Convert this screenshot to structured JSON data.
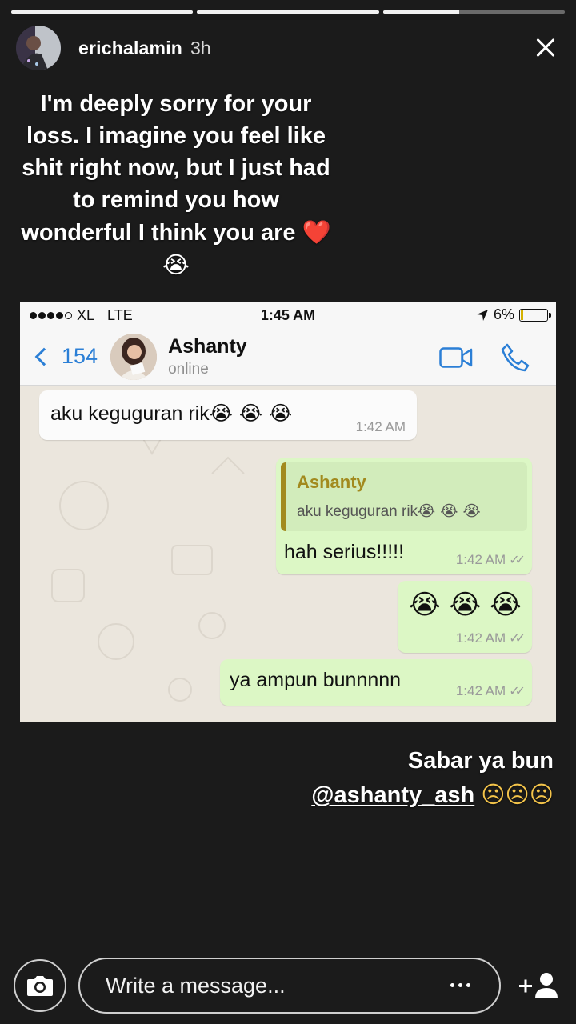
{
  "story": {
    "progress": [
      1.0,
      1.0,
      0.42
    ],
    "username": "erichalamin",
    "time": "3h",
    "avatar_icon": "user-avatar",
    "close_icon": "close-icon"
  },
  "caption": {
    "text": "I'm deeply sorry for your loss. I imagine you feel like shit right now, but I just had to remind you how wonderful I think you are",
    "emoji": "❤️😭"
  },
  "screenshot": {
    "status": {
      "carrier": "XL",
      "network": "LTE",
      "time": "1:45 AM",
      "battery": "6%"
    },
    "chat_header": {
      "back_count": "154",
      "contact_name": "Ashanty",
      "contact_status": "online"
    },
    "messages": [
      {
        "direction": "in",
        "text": "aku keguguran rik",
        "emoji": "😭 😭 😭",
        "time": "1:42 AM"
      },
      {
        "direction": "out",
        "quote_name": "Ashanty",
        "quote_text": "aku keguguran rik",
        "quote_emoji": "😭 😭 😭",
        "text": "hah serius!!!!!",
        "time": "1:42 AM"
      },
      {
        "direction": "out",
        "text": "😭 😭 😭",
        "time": "1:42 AM"
      },
      {
        "direction": "out",
        "text": "ya ampun bunnnnn",
        "time": "1:42 AM"
      }
    ]
  },
  "caption2": {
    "line1": "Sabar ya bun",
    "mention": "@ashanty_ash",
    "emoji": "☹☹☹"
  },
  "reply_bar": {
    "placeholder": "Write a message...",
    "camera_icon": "camera-icon",
    "more_icon": "more-dots-icon",
    "add_icon": "add-person-icon"
  }
}
